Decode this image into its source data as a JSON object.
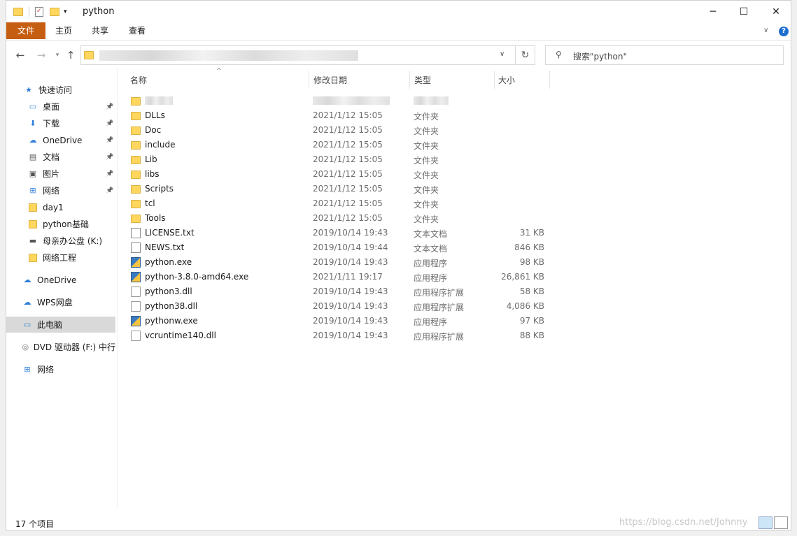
{
  "window": {
    "title": "python"
  },
  "ribbon": {
    "tabs": [
      "文件",
      "主页",
      "共享",
      "查看"
    ]
  },
  "search": {
    "placeholder": "搜索\"python\""
  },
  "sidebar": {
    "items": [
      {
        "label": "快速访问",
        "icon": "star-icon"
      },
      {
        "label": "桌面",
        "icon": "desktop-icon"
      },
      {
        "label": "下载",
        "icon": "download-icon"
      },
      {
        "label": "OneDrive",
        "icon": "cloud-icon"
      },
      {
        "label": "文档",
        "icon": "document-icon"
      },
      {
        "label": "图片",
        "icon": "picture-icon"
      },
      {
        "label": "网络",
        "icon": "network-icon"
      },
      {
        "label": "day1",
        "icon": "folder-icon"
      },
      {
        "label": "python基础",
        "icon": "folder-icon"
      },
      {
        "label": "母亲办公盘 (K:)",
        "icon": "drive-icon"
      },
      {
        "label": "网络工程",
        "icon": "folder-icon"
      },
      {
        "label": "OneDrive",
        "icon": "cloud-icon"
      },
      {
        "label": "WPS网盘",
        "icon": "cloud-icon"
      },
      {
        "label": "此电脑",
        "icon": "computer-icon"
      },
      {
        "label": "DVD 驱动器 (F:) 中行",
        "icon": "dvd-icon"
      },
      {
        "label": "网络",
        "icon": "network-icon"
      }
    ]
  },
  "columns": {
    "name": "名称",
    "date": "修改日期",
    "type": "类型",
    "size": "大小"
  },
  "files": [
    {
      "name": "DLLs",
      "date": "2021/1/12 15:05",
      "type": "文件夹",
      "size": "",
      "kind": "folder"
    },
    {
      "name": "Doc",
      "date": "2021/1/12 15:05",
      "type": "文件夹",
      "size": "",
      "kind": "folder"
    },
    {
      "name": "include",
      "date": "2021/1/12 15:05",
      "type": "文件夹",
      "size": "",
      "kind": "folder"
    },
    {
      "name": "Lib",
      "date": "2021/1/12 15:05",
      "type": "文件夹",
      "size": "",
      "kind": "folder"
    },
    {
      "name": "libs",
      "date": "2021/1/12 15:05",
      "type": "文件夹",
      "size": "",
      "kind": "folder"
    },
    {
      "name": "Scripts",
      "date": "2021/1/12 15:05",
      "type": "文件夹",
      "size": "",
      "kind": "folder"
    },
    {
      "name": "tcl",
      "date": "2021/1/12 15:05",
      "type": "文件夹",
      "size": "",
      "kind": "folder"
    },
    {
      "name": "Tools",
      "date": "2021/1/12 15:05",
      "type": "文件夹",
      "size": "",
      "kind": "folder"
    },
    {
      "name": "LICENSE.txt",
      "date": "2019/10/14 19:43",
      "type": "文本文档",
      "size": "31 KB",
      "kind": "txt"
    },
    {
      "name": "NEWS.txt",
      "date": "2019/10/14 19:44",
      "type": "文本文档",
      "size": "846 KB",
      "kind": "txt"
    },
    {
      "name": "python.exe",
      "date": "2019/10/14 19:43",
      "type": "应用程序",
      "size": "98 KB",
      "kind": "exe"
    },
    {
      "name": "python-3.8.0-amd64.exe",
      "date": "2021/1/11 19:17",
      "type": "应用程序",
      "size": "26,861 KB",
      "kind": "exe"
    },
    {
      "name": "python3.dll",
      "date": "2019/10/14 19:43",
      "type": "应用程序扩展",
      "size": "58 KB",
      "kind": "dll"
    },
    {
      "name": "python38.dll",
      "date": "2019/10/14 19:43",
      "type": "应用程序扩展",
      "size": "4,086 KB",
      "kind": "dll"
    },
    {
      "name": "pythonw.exe",
      "date": "2019/10/14 19:43",
      "type": "应用程序",
      "size": "97 KB",
      "kind": "exe"
    },
    {
      "name": "vcruntime140.dll",
      "date": "2019/10/14 19:43",
      "type": "应用程序扩展",
      "size": "88 KB",
      "kind": "dll"
    }
  ],
  "status": {
    "count": "17 个项目"
  },
  "watermark": "https://blog.csdn.net/Johnny"
}
